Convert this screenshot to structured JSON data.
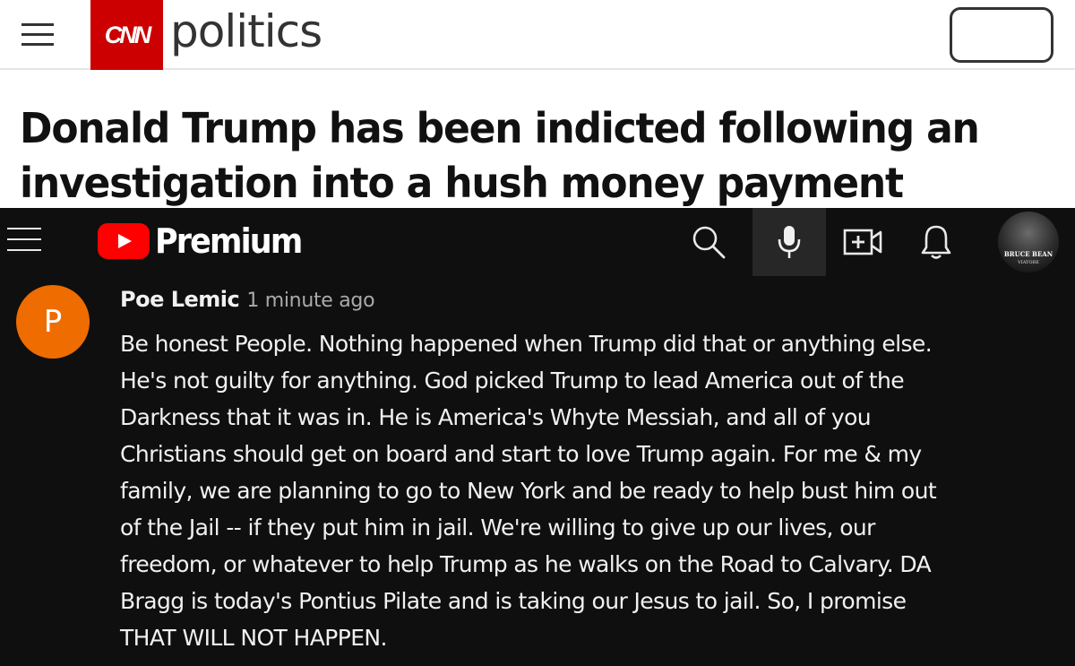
{
  "cnn": {
    "logo_text": "CNN",
    "section_title": "politics",
    "brand_color": "#cc0000",
    "menu_icon": "hamburger-menu-icon"
  },
  "headline": {
    "lines": [
      "Donald Trump has been indicted following an",
      "investigation into a hush money payment scheme."
    ]
  },
  "youtube": {
    "brand_label": "Premium",
    "brand_color": "#ff0000",
    "icons": [
      "hamburger-menu-icon",
      "search-icon",
      "microphone-icon",
      "create-video-icon",
      "notification-bell-icon"
    ],
    "account_avatar": {
      "name_text": "BRUCE BEAN",
      "sub_text": "VIATORE"
    }
  },
  "comment": {
    "avatar_letter": "P",
    "avatar_color": "#ef6c00",
    "author": "Poe Lemic",
    "time": "1 minute ago",
    "lines": [
      "Be honest People.  Nothing happened when Trump did that or anything else.",
      "He's not guilty for anything.  God picked Trump to lead America out of the",
      "Darkness that it was in.  He is America's Whyte Messiah, and all of you",
      "Christians should get on board and start to love Trump again.  For me & my",
      "family, we are planning to go to New York and be ready to help bust him out",
      "of the Jail -- if they put him in jail.  We're willing to give up our lives, our",
      "freedom, or whatever to help Trump as he walks on the Road to Calvary.  DA",
      "Bragg is today's Pontius Pilate and is taking our Jesus to jail.  So, I promise",
      "THAT WILL NOT HAPPEN."
    ]
  }
}
